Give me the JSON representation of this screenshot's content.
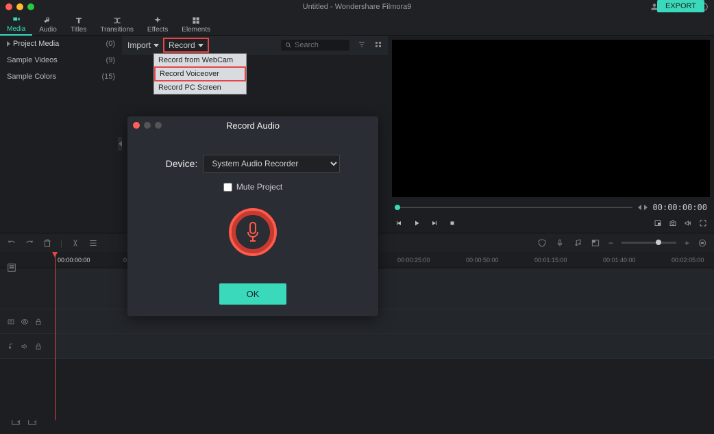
{
  "window": {
    "title": "Untitled - Wondershare Filmora9"
  },
  "tabs": [
    {
      "label": "Media"
    },
    {
      "label": "Audio"
    },
    {
      "label": "Titles"
    },
    {
      "label": "Transitions"
    },
    {
      "label": "Effects"
    },
    {
      "label": "Elements"
    }
  ],
  "sidebar": {
    "items": [
      {
        "label": "Project Media",
        "count": "(0)"
      },
      {
        "label": "Sample Videos",
        "count": "(9)"
      },
      {
        "label": "Sample Colors",
        "count": "(15)"
      }
    ]
  },
  "mediabar": {
    "import": "Import",
    "record": "Record",
    "search_placeholder": "Search",
    "export": "EXPORT"
  },
  "record_menu": [
    "Record from WebCam",
    "Record Voiceover",
    "Record PC Screen"
  ],
  "preview": {
    "timecode": "00:00:00:00"
  },
  "timeline": {
    "playhead_time": "00:00:00:00",
    "marks": [
      "0",
      "00:00:25:00",
      "00:00:50:00",
      "00:01:15:00",
      "00:01:40:00",
      "00:02:05:00"
    ]
  },
  "modal": {
    "title": "Record Audio",
    "device_label": "Device:",
    "device_value": "System Audio Recorder",
    "mute_label": "Mute Project",
    "ok": "OK"
  }
}
